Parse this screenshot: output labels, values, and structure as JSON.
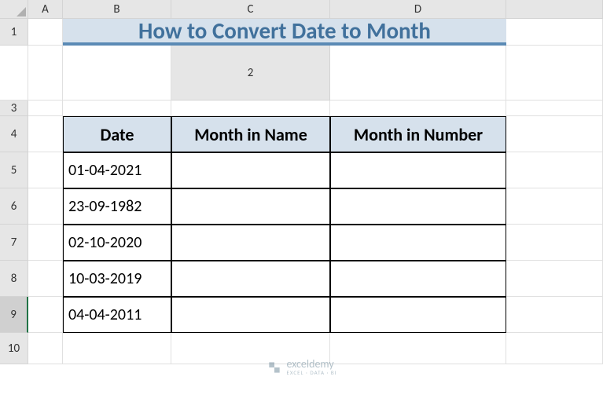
{
  "columns": [
    "A",
    "B",
    "C",
    "D"
  ],
  "rows": [
    "1",
    "2",
    "3",
    "4",
    "5",
    "6",
    "7",
    "8",
    "9",
    "10"
  ],
  "title": "How to Convert Date to Month",
  "headers": {
    "date": "Date",
    "monthName": "Month in Name",
    "monthNumber": "Month in Number"
  },
  "data": {
    "row5": {
      "date": "01-04-2021",
      "monthName": "",
      "monthNumber": ""
    },
    "row6": {
      "date": "23-09-1982",
      "monthName": "",
      "monthNumber": ""
    },
    "row7": {
      "date": "02-10-2020",
      "monthName": "",
      "monthNumber": ""
    },
    "row8": {
      "date": "10-03-2019",
      "monthName": "",
      "monthNumber": ""
    },
    "row9": {
      "date": "04-04-2011",
      "monthName": "",
      "monthNumber": ""
    }
  },
  "watermark": {
    "name": "exceldemy",
    "tagline": "EXCEL · DATA · BI"
  },
  "activeRow": "9"
}
